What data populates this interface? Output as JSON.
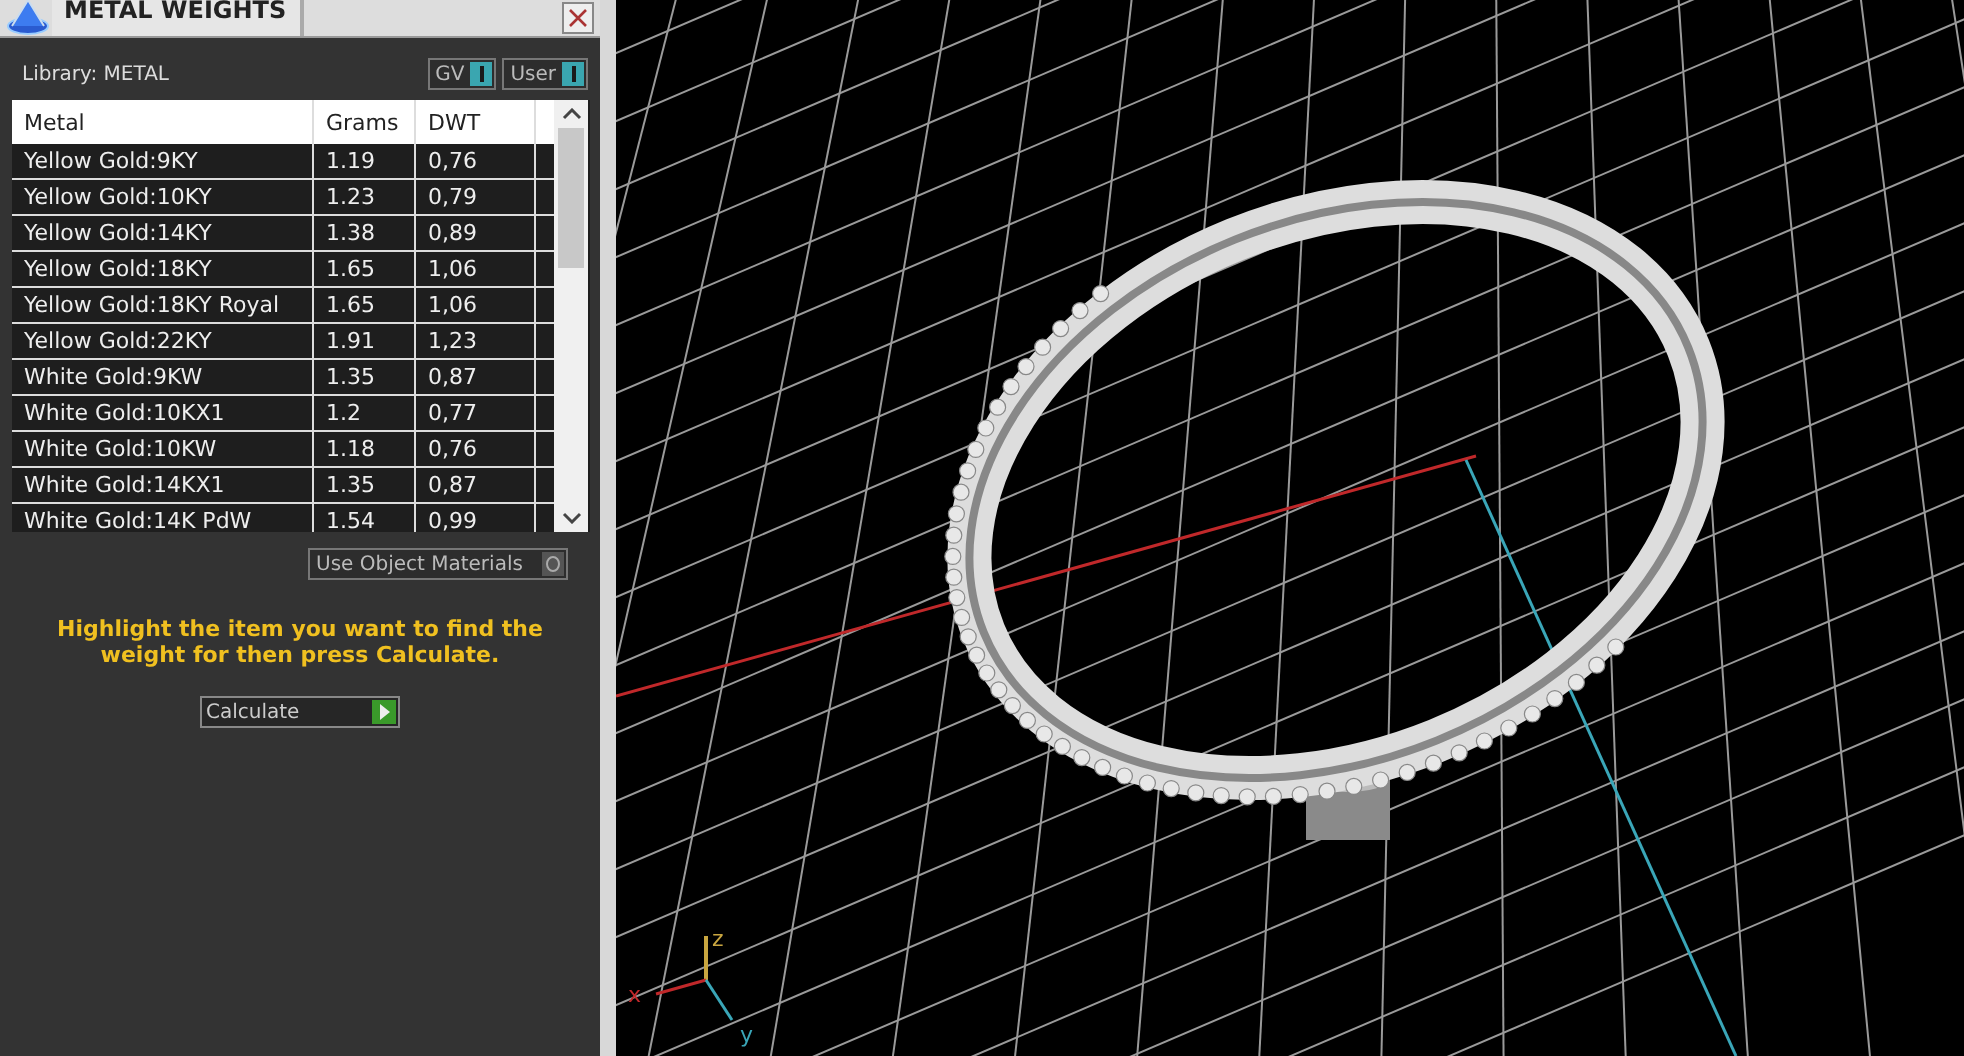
{
  "window": {
    "title": "METAL WEIGHTS"
  },
  "library": {
    "label": "Library: METAL"
  },
  "toggles": [
    {
      "label": "GV",
      "on": true
    },
    {
      "label": "User",
      "on": true
    }
  ],
  "table": {
    "columns": [
      "Metal",
      "Grams",
      "DWT"
    ],
    "rows": [
      {
        "cells": [
          "Yellow Gold:9KY",
          "1.19",
          "0,76"
        ]
      },
      {
        "cells": [
          "Yellow Gold:10KY",
          "1.23",
          "0,79"
        ]
      },
      {
        "cells": [
          "Yellow Gold:14KY",
          "1.38",
          "0,89"
        ]
      },
      {
        "cells": [
          "Yellow Gold:18KY",
          "1.65",
          "1,06"
        ]
      },
      {
        "cells": [
          "Yellow Gold:18KY Royal",
          "1.65",
          "1,06"
        ]
      },
      {
        "cells": [
          "Yellow Gold:22KY",
          "1.91",
          "1,23"
        ]
      },
      {
        "cells": [
          "White Gold:9KW",
          "1.35",
          "0,87"
        ]
      },
      {
        "cells": [
          "White Gold:10KX1",
          "1.2",
          "0,77"
        ]
      },
      {
        "cells": [
          "White Gold:10KW",
          "1.18",
          "0,76"
        ]
      },
      {
        "cells": [
          "White Gold:14KX1",
          "1.35",
          "0,87"
        ]
      },
      {
        "cells": [
          "White Gold:14K PdW",
          "1.54",
          "0,99"
        ]
      }
    ]
  },
  "use_object_materials": {
    "label": "Use Object Materials",
    "on": false
  },
  "hint": "Highlight the item you want to find the weight for then press Calculate.",
  "calculate": {
    "label": "Calculate"
  },
  "viewport": {
    "axes": {
      "x": "x",
      "y": "y",
      "z": "z"
    }
  }
}
